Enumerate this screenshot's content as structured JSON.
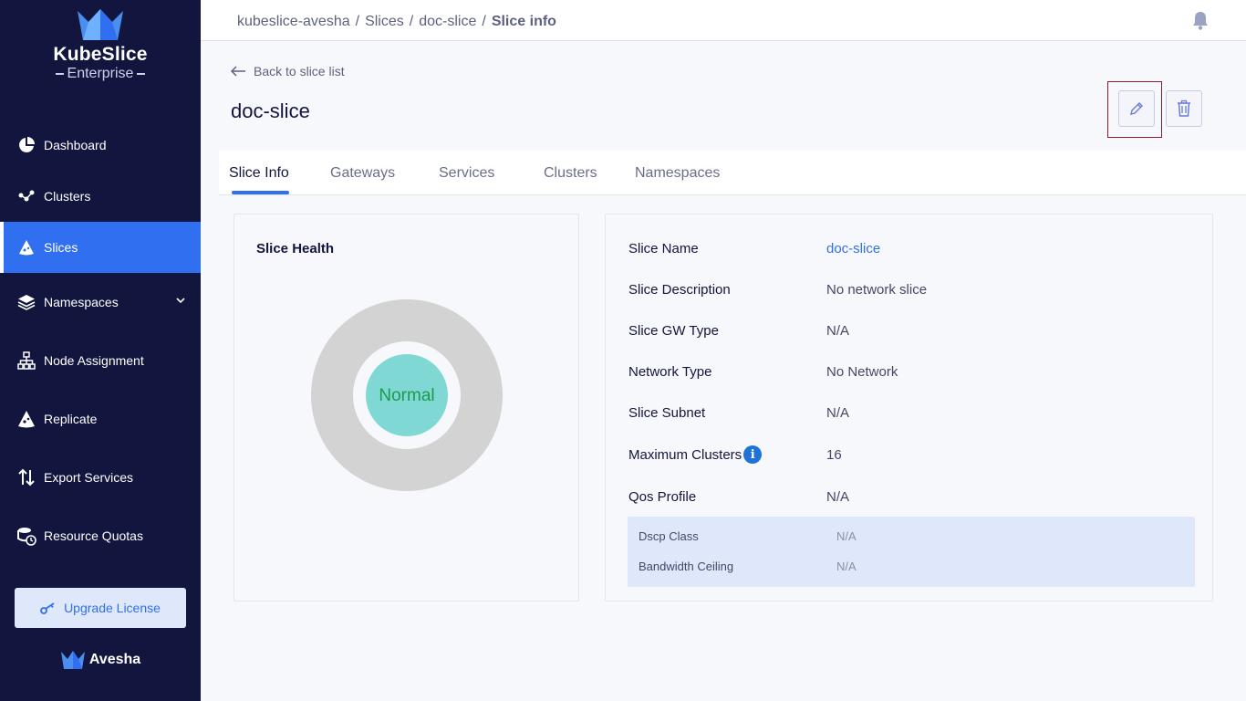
{
  "brand": {
    "name": "KubeSlice",
    "edition": "Enterprise",
    "footer": "Avesha"
  },
  "nav": [
    {
      "label": "Dashboard",
      "icon": "dashboard-icon"
    },
    {
      "label": "Clusters",
      "icon": "clusters-icon"
    },
    {
      "label": "Slices",
      "icon": "slices-icon",
      "active": true
    },
    {
      "label": "Namespaces",
      "icon": "namespaces-icon"
    },
    {
      "label": "Node Assignment",
      "icon": "node-assignment-icon"
    },
    {
      "label": "Replicate",
      "icon": "replicate-icon"
    },
    {
      "label": "Export Services",
      "icon": "export-services-icon"
    },
    {
      "label": "Resource Quotas",
      "icon": "resource-quotas-icon"
    }
  ],
  "upgrade_label": "Upgrade License",
  "breadcrumb": {
    "project": "kubeslice-avesha",
    "sep": "/",
    "slices": "Slices",
    "slice": "doc-slice",
    "current": "Slice info"
  },
  "back_label": "Back to slice list",
  "page_title": "doc-slice",
  "tabs": [
    "Slice Info",
    "Gateways",
    "Services",
    "Clusters",
    "Namespaces"
  ],
  "health": {
    "title": "Slice Health",
    "status": "Normal"
  },
  "info": {
    "slice_name": {
      "label": "Slice Name",
      "value": "doc-slice"
    },
    "description": {
      "label": "Slice Description",
      "value": "No network slice"
    },
    "gw_type": {
      "label": "Slice GW Type",
      "value": "N/A"
    },
    "network_type": {
      "label": "Network Type",
      "value": "No Network"
    },
    "subnet": {
      "label": "Slice Subnet",
      "value": "N/A"
    },
    "max_clusters": {
      "label": "Maximum Clusters",
      "value": "16"
    },
    "qos": {
      "label": "Qos Profile",
      "value": "N/A"
    },
    "dscp": {
      "label": "Dscp Class",
      "value": "N/A"
    },
    "bandwidth": {
      "label": "Bandwidth Ceiling",
      "value": "N/A"
    }
  },
  "colors": {
    "sidebar": "#12153e",
    "accent": "#2f6ff0",
    "healthy": "#7fd8d4",
    "healthy_text": "#1e9a4d",
    "ring": "#d3d3d3"
  }
}
